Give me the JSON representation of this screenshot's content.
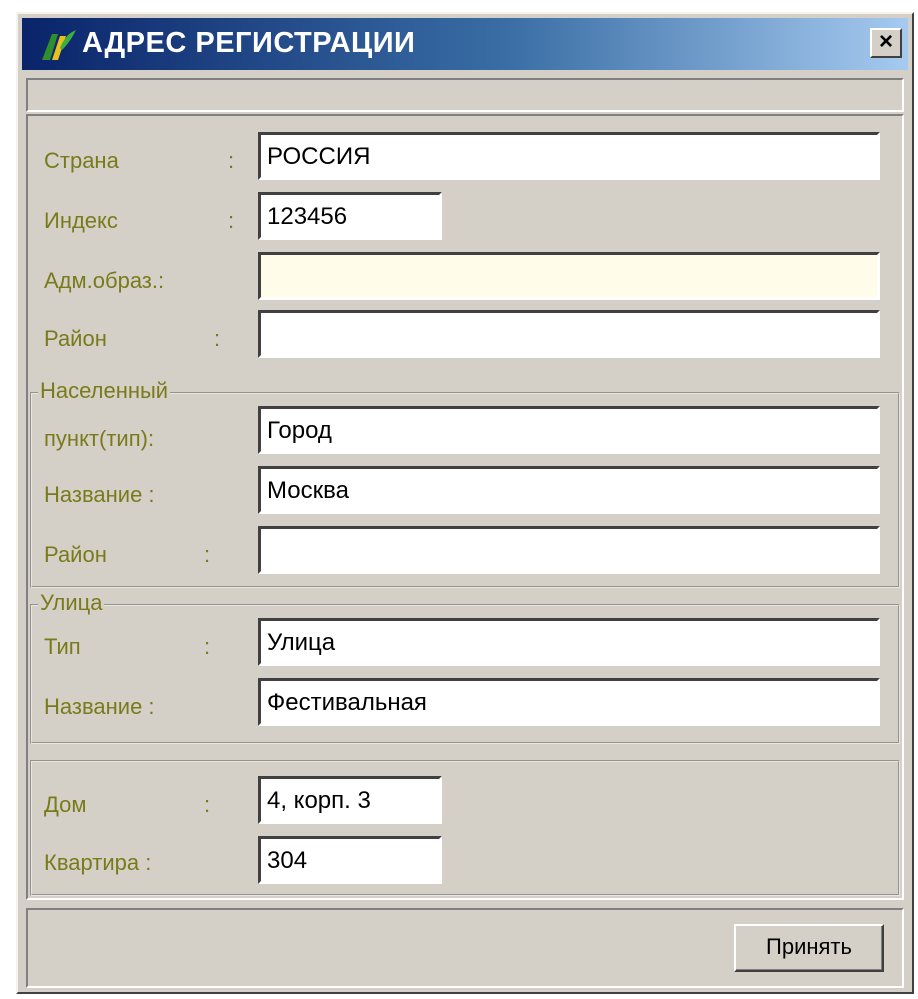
{
  "window": {
    "title": "АДРЕС РЕГИСТРАЦИИ",
    "close_label": "×"
  },
  "address": {
    "country_label": "Страна",
    "country_value": "РОССИЯ",
    "index_label": "Индекс",
    "index_value": "123456",
    "adm_label": "Адм.образ.:",
    "adm_value": "",
    "district_label": "Район",
    "district_value": ""
  },
  "settlement": {
    "group_title": "Населенный",
    "type_label": "пункт(тип):",
    "type_value": "Город",
    "name_label": "Название :",
    "name_value": "Москва",
    "district_label": "Район",
    "district_value": ""
  },
  "street": {
    "group_title": "Улица",
    "type_label": "Тип",
    "type_value": "Улица",
    "name_label": "Название :",
    "name_value": "Фестивальная"
  },
  "building": {
    "house_label": "Дом",
    "house_value": "4, корп. 3",
    "apartment_label": "Квартира :",
    "apartment_value": "304"
  },
  "footer": {
    "accept_label": "Принять"
  },
  "colon": ":",
  "colors": {
    "title_gradient_start": "#0a246a",
    "title_gradient_end": "#a6caf0",
    "label_color": "#7a7a1a",
    "face": "#d4d0c8",
    "highlight_field": "#fffdea"
  }
}
